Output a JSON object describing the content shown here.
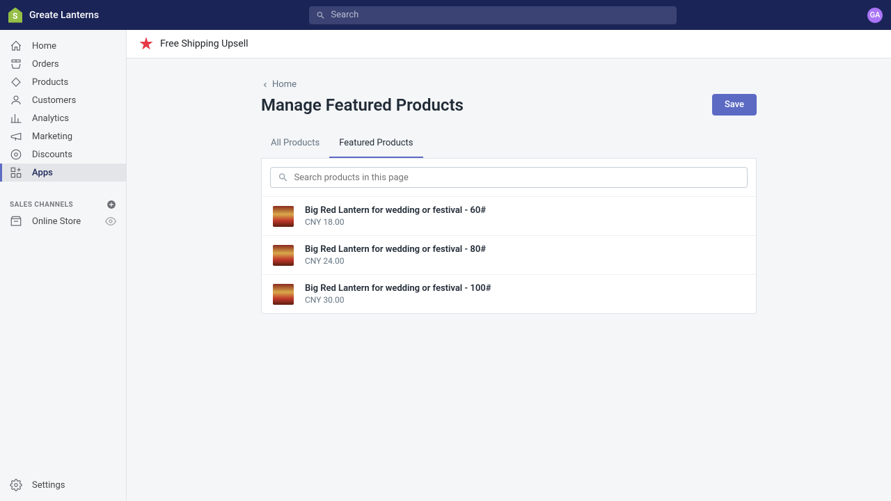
{
  "header": {
    "store_name": "Greate Lanterns",
    "search_placeholder": "Search",
    "avatar_initials": "GA"
  },
  "sidebar": {
    "items": [
      {
        "label": "Home",
        "icon": "home"
      },
      {
        "label": "Orders",
        "icon": "orders"
      },
      {
        "label": "Products",
        "icon": "products"
      },
      {
        "label": "Customers",
        "icon": "customers"
      },
      {
        "label": "Analytics",
        "icon": "analytics"
      },
      {
        "label": "Marketing",
        "icon": "marketing"
      },
      {
        "label": "Discounts",
        "icon": "discounts"
      },
      {
        "label": "Apps",
        "icon": "apps"
      }
    ],
    "section_label": "SALES CHANNELS",
    "channels": [
      {
        "label": "Online Store"
      }
    ],
    "settings_label": "Settings"
  },
  "app": {
    "title": "Free Shipping Upsell"
  },
  "page": {
    "breadcrumb": "Home",
    "title": "Manage Featured Products",
    "save_label": "Save",
    "tabs": [
      {
        "label": "All Products"
      },
      {
        "label": "Featured Products"
      }
    ],
    "product_search_placeholder": "Search products in this page",
    "products": [
      {
        "name": "Big Red Lantern for wedding or festival - 60#",
        "price": "CNY 18.00"
      },
      {
        "name": "Big Red Lantern for wedding or festival - 80#",
        "price": "CNY 24.00"
      },
      {
        "name": "Big Red Lantern for wedding or festival - 100#",
        "price": "CNY 30.00"
      }
    ]
  }
}
